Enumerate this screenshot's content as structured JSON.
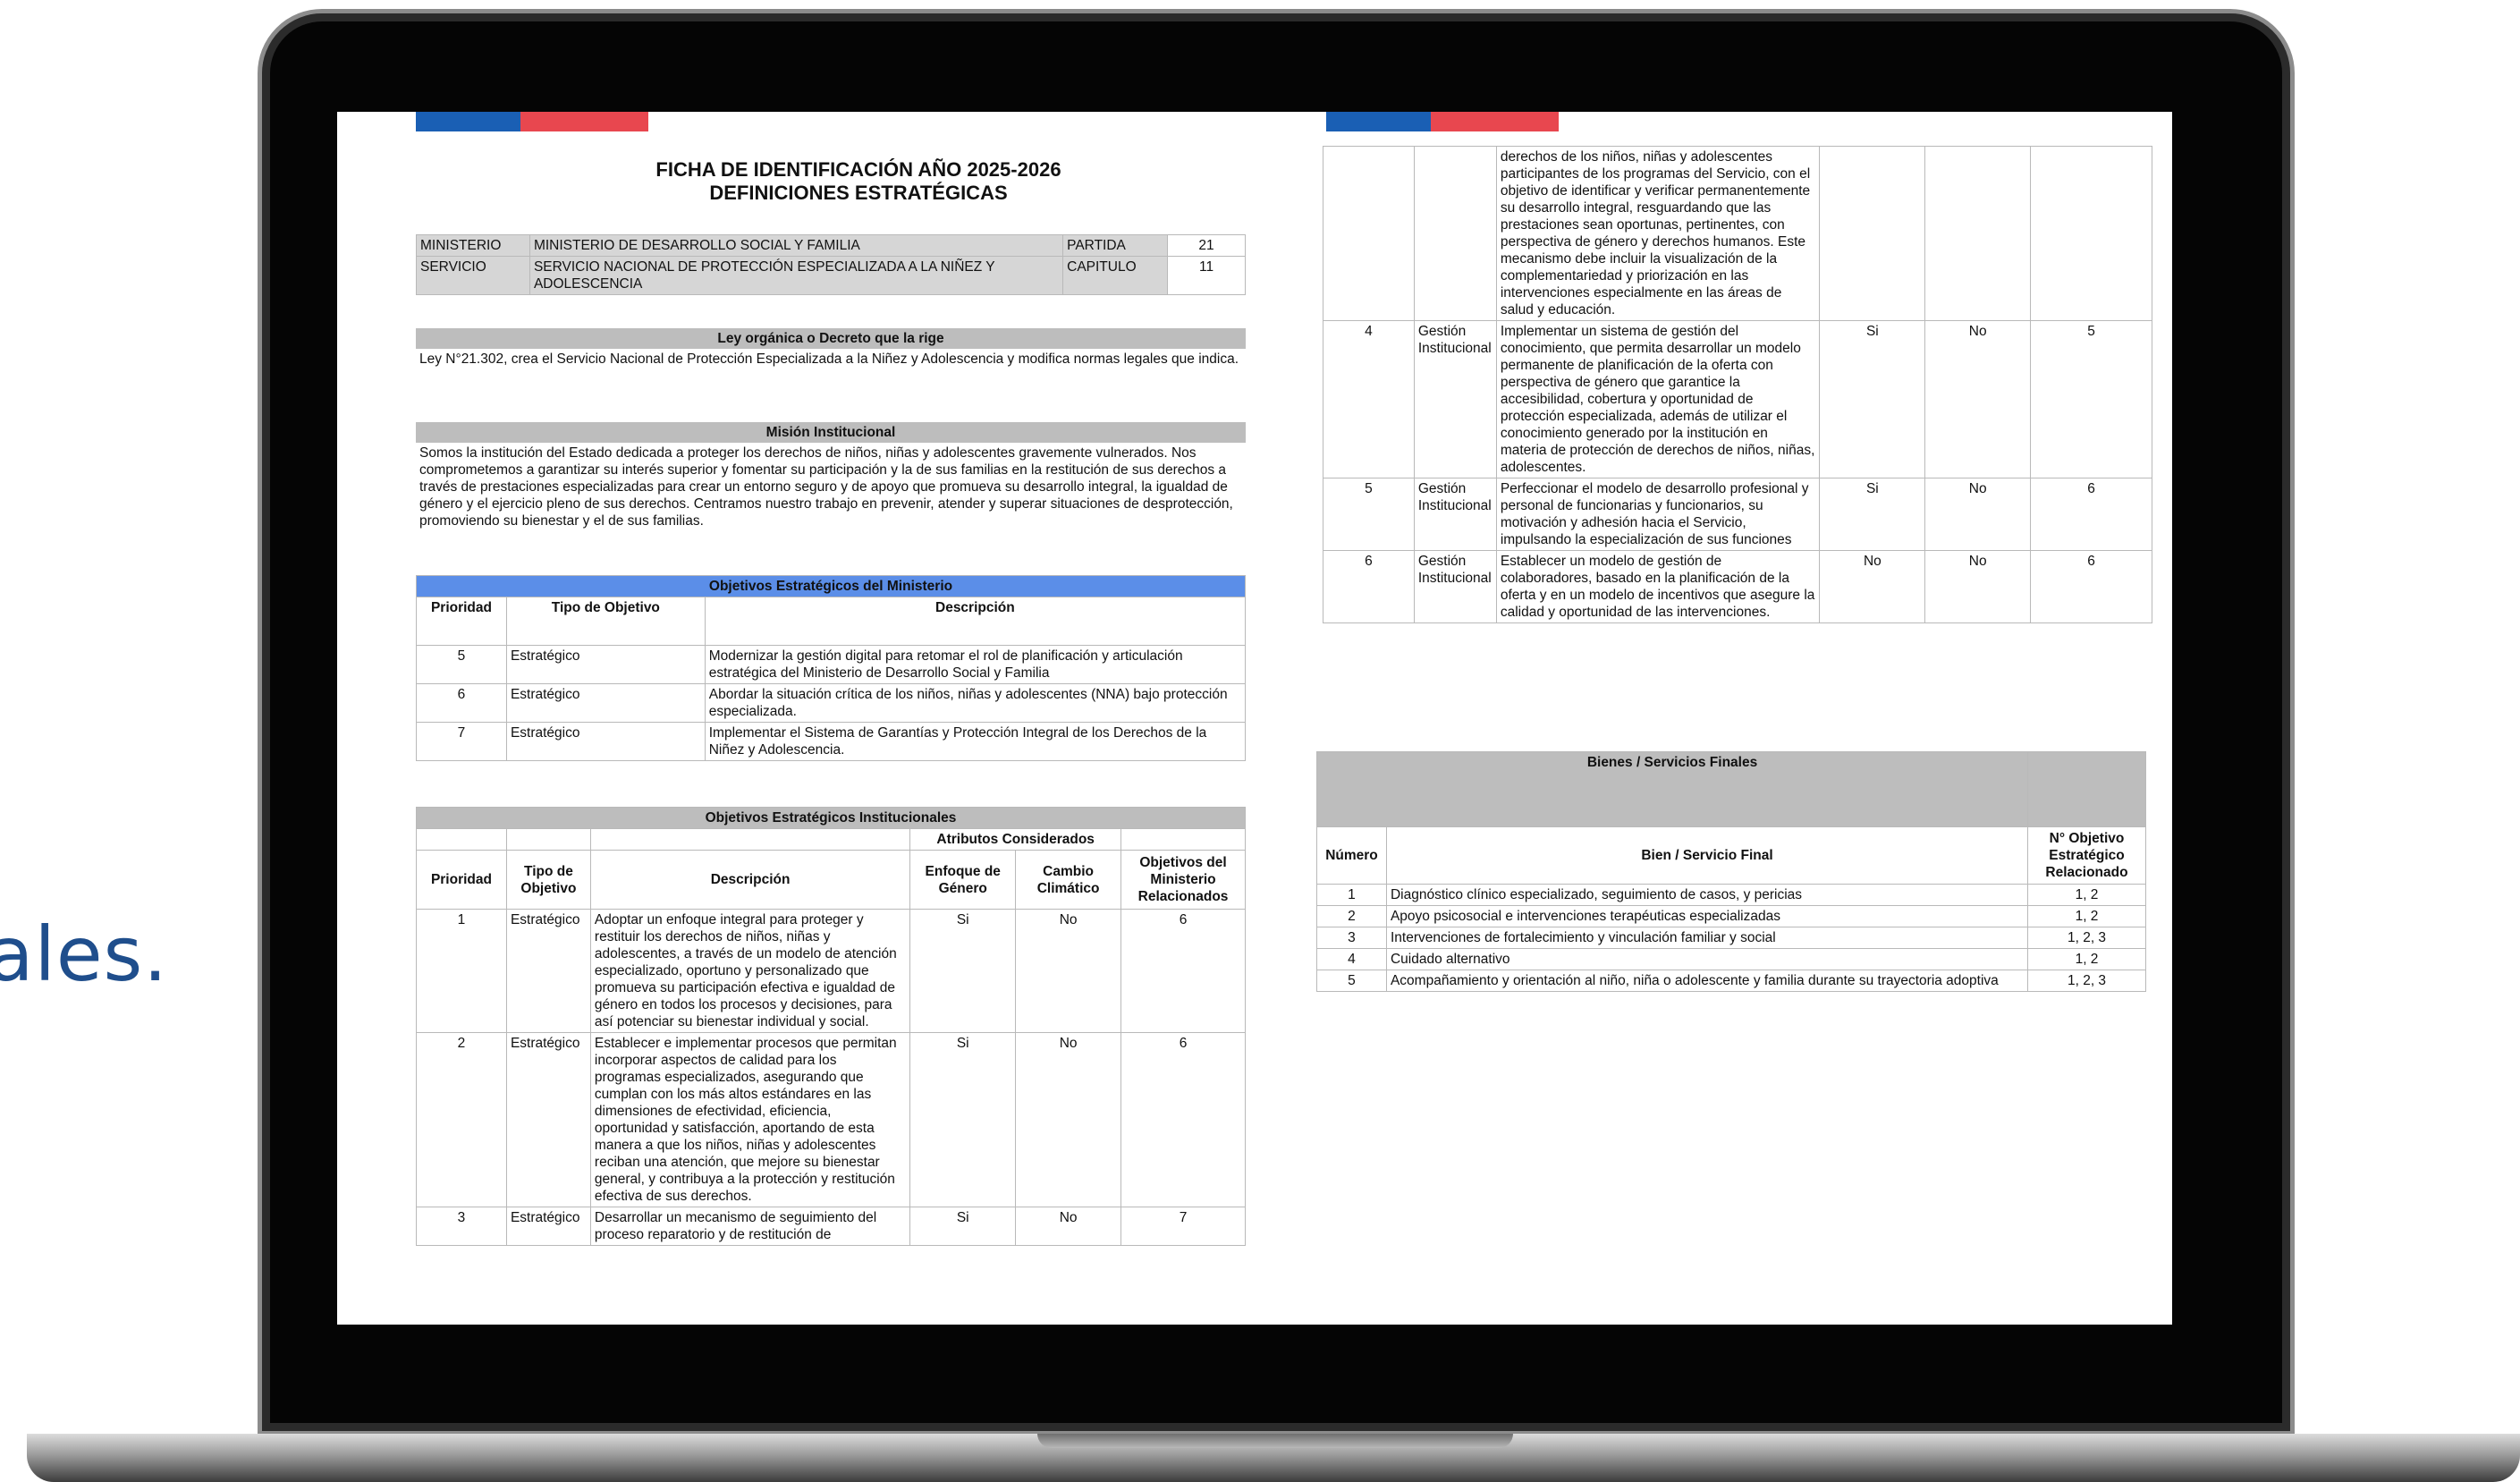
{
  "side_text": "ales.",
  "left_page": {
    "title_line1": "FICHA DE IDENTIFICACIÓN AÑO 2025-2026",
    "title_line2": "DEFINICIONES ESTRATÉGICAS",
    "id_table": [
      {
        "label": "MINISTERIO",
        "value": "MINISTERIO DE DESARROLLO SOCIAL Y FAMILIA",
        "label2": "PARTIDA",
        "value2": "21"
      },
      {
        "label": "SERVICIO",
        "value": "SERVICIO NACIONAL DE PROTECCIÓN ESPECIALIZADA A LA NIÑEZ Y ADOLESCENCIA",
        "label2": "CAPITULO",
        "value2": "11"
      }
    ],
    "ley_header": "Ley orgánica o Decreto que la rige",
    "ley_text": "Ley N°21.302, crea el Servicio Nacional de Protección Especializada a la Niñez y Adolescencia y modifica normas legales que indica.",
    "mision_header": "Misión Institucional",
    "mision_text": "Somos la institución del Estado dedicada a proteger los derechos de niños, niñas y adolescentes gravemente vulnerados. Nos comprometemos a garantizar su interés superior y fomentar su participación y la de sus familias en la restitución de sus derechos a través de prestaciones especializadas para crear un entorno seguro y de apoyo que promueva su desarrollo integral, la igualdad de género y el ejercicio pleno de sus derechos. Centramos nuestro trabajo en prevenir, atender y superar situaciones de desprotección, promoviendo su bienestar y el de sus familias.",
    "ministerio_header": "Objetivos Estratégicos del Ministerio",
    "ministerio_cols": [
      "Prioridad",
      "Tipo de Objetivo",
      "Descripción"
    ],
    "ministerio_rows": [
      {
        "prioridad": "5",
        "tipo": "Estratégico",
        "descripcion": "Modernizar la gestión digital para retomar el rol de planificación y articulación estratégica del Ministerio de Desarrollo Social y Familia"
      },
      {
        "prioridad": "6",
        "tipo": "Estratégico",
        "descripcion": "Abordar la situación crítica de los niños, niñas y adolescentes (NNA) bajo protección especializada."
      },
      {
        "prioridad": "7",
        "tipo": "Estratégico",
        "descripcion": "Implementar el Sistema de Garantías y Protección Integral de los Derechos de la Niñez y Adolescencia."
      }
    ],
    "inst_header": "Objetivos Estratégicos Institucionales",
    "inst_attr_header": "Atributos Considerados",
    "inst_cols": [
      "Prioridad",
      "Tipo de Objetivo",
      "Descripción",
      "Enfoque de Género",
      "Cambio Climático",
      "Objetivos del Ministerio Relacionados"
    ],
    "inst_rows": [
      {
        "prioridad": "1",
        "tipo": "Estratégico",
        "descripcion": "Adoptar un enfoque integral para proteger y restituir los derechos de niños, niñas y adolescentes, a través de un modelo de atención especializado, oportuno y personalizado que promueva su participación efectiva e igualdad de género en todos los procesos y decisiones, para así potenciar su bienestar individual y social.",
        "genero": "Si",
        "clima": "No",
        "relacionados": "6"
      },
      {
        "prioridad": "2",
        "tipo": "Estratégico",
        "descripcion": "Establecer e implementar procesos que permitan incorporar aspectos de calidad para los programas especializados, asegurando que cumplan con los más altos estándares en las dimensiones de efectividad, eficiencia, oportunidad y satisfacción, aportando de esta manera a que los niños, niñas y adolescentes reciban una atención, que mejore su bienestar general, y contribuya a la protección y restitución efectiva de sus derechos.",
        "genero": "Si",
        "clima": "No",
        "relacionados": "6"
      },
      {
        "prioridad": "3",
        "tipo": "Estratégico",
        "descripcion": "Desarrollar un mecanismo de seguimiento del proceso reparatorio y de restitución de",
        "genero": "Si",
        "clima": "No",
        "relacionados": "7"
      }
    ]
  },
  "right_page": {
    "cont_row": {
      "descripcion": "derechos de los niños, niñas y adolescentes participantes de los programas del Servicio, con el objetivo de identificar y verificar permanentemente su desarrollo integral, resguardando que las prestaciones sean oportunas, pertinentes, con perspectiva de género y derechos humanos. Este mecanismo debe incluir la visualización de la complementariedad y priorización en las intervenciones especialmente en las áreas de salud y educación."
    },
    "inst_rows": [
      {
        "prioridad": "4",
        "tipo": "Gestión Institucional",
        "descripcion": "Implementar un sistema de gestión del conocimiento, que permita desarrollar un modelo permanente de planificación de la oferta con perspectiva de género que garantice la accesibilidad, cobertura y oportunidad de protección especializada, además de utilizar el conocimiento generado por la institución en materia de protección de derechos de niños, niñas, adolescentes.",
        "genero": "Si",
        "clima": "No",
        "relacionados": "5"
      },
      {
        "prioridad": "5",
        "tipo": "Gestión Institucional",
        "descripcion": "Perfeccionar el modelo de desarrollo profesional y personal de funcionarias y funcionarios, su motivación y adhesión hacia el Servicio, impulsando la especialización de sus funciones",
        "genero": "Si",
        "clima": "No",
        "relacionados": "6"
      },
      {
        "prioridad": "6",
        "tipo": "Gestión Institucional",
        "descripcion": "Establecer un modelo de gestión de colaboradores, basado en la planificación de la oferta y en un modelo de incentivos que asegure la calidad y oportunidad de las intervenciones.",
        "genero": "No",
        "clima": "No",
        "relacionados": "6"
      }
    ],
    "bienes_header": "Bienes / Servicios Finales",
    "bienes_cols": [
      "Número",
      "Bien / Servicio Final",
      "N° Objetivo Estratégico Relacionado"
    ],
    "bienes_rows": [
      {
        "numero": "1",
        "bien": "Diagnóstico clínico especializado, seguimiento de casos, y pericias",
        "objetivo": "1, 2"
      },
      {
        "numero": "2",
        "bien": "Apoyo psicosocial e intervenciones terapéuticas especializadas",
        "objetivo": "1, 2"
      },
      {
        "numero": "3",
        "bien": "Intervenciones de fortalecimiento y vinculación familiar y social",
        "objetivo": "1, 2, 3"
      },
      {
        "numero": "4",
        "bien": "Cuidado alternativo",
        "objetivo": "1, 2"
      },
      {
        "numero": "5",
        "bien": "Acompañamiento y orientación al niño, niña o adolescente y familia durante su trayectoria adoptiva",
        "objetivo": "1, 2, 3"
      }
    ]
  }
}
